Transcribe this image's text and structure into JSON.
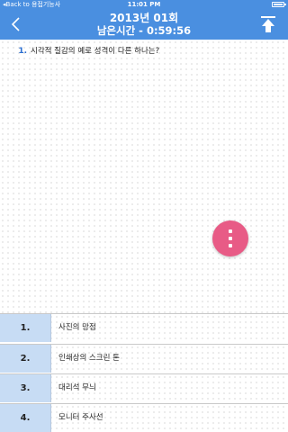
{
  "status_bar": {
    "back_label": "◂Back to 용접기능사",
    "time": "11:01 PM"
  },
  "nav": {
    "title": "2013년 01회",
    "subtitle": "남은시간 - 0:59:56",
    "back_icon": "chevron-left-icon",
    "top_icon": "arrow-up-to-top-icon"
  },
  "question": {
    "number": "1.",
    "text": "시각적 질감의 예로 성격이 다른 하나는?"
  },
  "fab": {
    "icon": "more-vertical-icon",
    "color": "#e85b86"
  },
  "answers": [
    {
      "number": "1.",
      "text": "사진의 망점"
    },
    {
      "number": "2.",
      "text": "인쇄상의 스크린 톤"
    },
    {
      "number": "3.",
      "text": "대리석 무늬"
    },
    {
      "number": "4.",
      "text": "모니터 주사선"
    }
  ],
  "colors": {
    "header": "#4a8fe0",
    "answer_number_bg": "#c7dcf4",
    "question_number": "#2d6fd0"
  }
}
